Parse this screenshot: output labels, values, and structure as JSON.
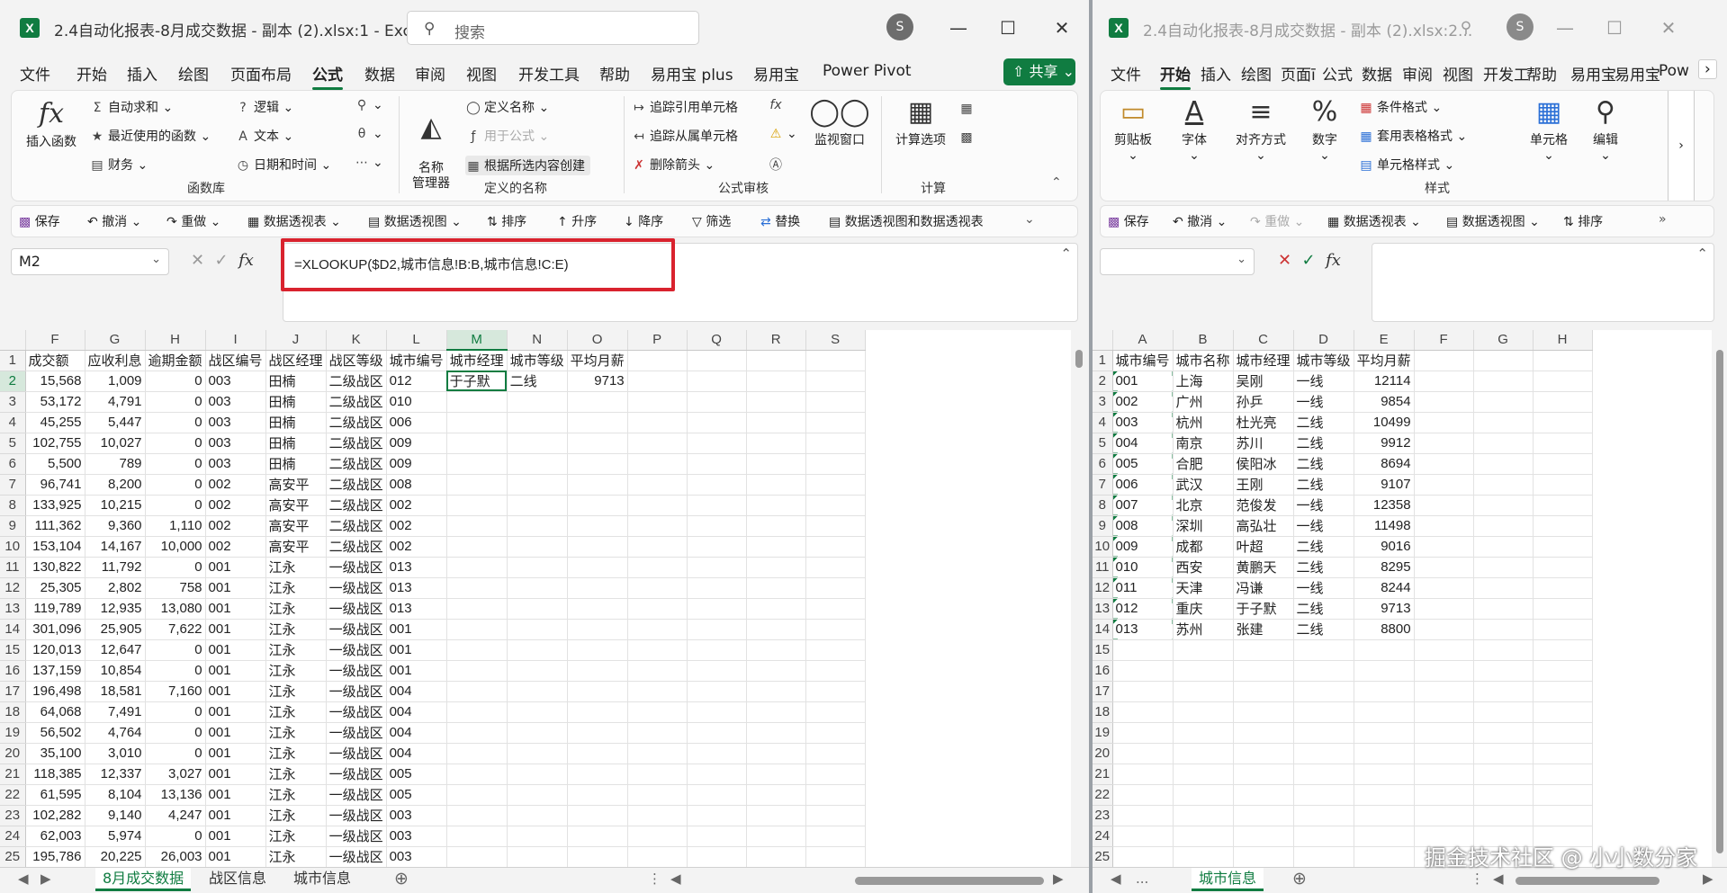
{
  "left": {
    "title": "2.4自动化报表-8月成交数据 - 副本 (2).xlsx:1  -  Excel",
    "logo": "X",
    "search_placeholder": "搜索",
    "avatar": "S",
    "menu": [
      "文件",
      "开始",
      "插入",
      "绘图",
      "页面布局",
      "公式",
      "数据",
      "审阅",
      "视图",
      "开发工具",
      "帮助",
      "易用宝 plus",
      "易用宝",
      "Power Pivot"
    ],
    "share": "共享",
    "ribbon": {
      "insert_function": "插入函数",
      "autosum": "自动求和",
      "recent": "最近使用的函数",
      "financial": "财务",
      "logical": "逻辑",
      "text": "文本",
      "datetime": "日期和时间",
      "group_library": "函数库",
      "name_manager": "名称\n管理器",
      "define_name": "定义名称",
      "use_in_formula": "用于公式",
      "create_from_selection": "根据所选内容创建",
      "group_names": "定义的名称",
      "trace_precedents": "追踪引用单元格",
      "trace_dependents": "追踪从属单元格",
      "remove_arrows": "删除箭头",
      "watch_window": "监视窗口",
      "group_audit": "公式审核",
      "calc_options": "计算选项",
      "group_calc": "计算"
    },
    "qat": [
      "保存",
      "撤消",
      "重做",
      "数据透视表",
      "数据透视图",
      "排序",
      "升序",
      "降序",
      "筛选",
      "替换",
      "数据透视图和数据透视表"
    ],
    "namebox": "M2",
    "formula": "=XLOOKUP($D2,城市信息!B:B,城市信息!C:E)",
    "columns": [
      "F",
      "G",
      "H",
      "I",
      "J",
      "K",
      "L",
      "M",
      "N",
      "O",
      "P",
      "Q",
      "R",
      "S"
    ],
    "rows": [
      [
        "成交额",
        "应收利息",
        "逾期金额",
        "战区编号",
        "战区经理",
        "战区等级",
        "城市编号",
        "城市经理",
        "城市等级",
        "平均月薪",
        "",
        "",
        "",
        ""
      ],
      [
        "15,568",
        "1,009",
        "0",
        "003",
        "田楠",
        "二级战区",
        "012",
        "于子默",
        "二线",
        "9713",
        "",
        "",
        "",
        ""
      ],
      [
        "53,172",
        "4,791",
        "0",
        "003",
        "田楠",
        "二级战区",
        "010",
        "",
        "",
        "",
        "",
        "",
        "",
        ""
      ],
      [
        "45,255",
        "5,447",
        "0",
        "003",
        "田楠",
        "二级战区",
        "006",
        "",
        "",
        "",
        "",
        "",
        "",
        ""
      ],
      [
        "102,755",
        "10,027",
        "0",
        "003",
        "田楠",
        "二级战区",
        "009",
        "",
        "",
        "",
        "",
        "",
        "",
        ""
      ],
      [
        "5,500",
        "789",
        "0",
        "003",
        "田楠",
        "二级战区",
        "009",
        "",
        "",
        "",
        "",
        "",
        "",
        ""
      ],
      [
        "96,741",
        "8,200",
        "0",
        "002",
        "高安平",
        "二级战区",
        "008",
        "",
        "",
        "",
        "",
        "",
        "",
        ""
      ],
      [
        "133,925",
        "10,215",
        "0",
        "002",
        "高安平",
        "二级战区",
        "002",
        "",
        "",
        "",
        "",
        "",
        "",
        ""
      ],
      [
        "111,362",
        "9,360",
        "1,110",
        "002",
        "高安平",
        "二级战区",
        "002",
        "",
        "",
        "",
        "",
        "",
        "",
        ""
      ],
      [
        "153,104",
        "14,167",
        "10,000",
        "002",
        "高安平",
        "二级战区",
        "002",
        "",
        "",
        "",
        "",
        "",
        "",
        ""
      ],
      [
        "130,822",
        "11,792",
        "0",
        "001",
        "江永",
        "一级战区",
        "013",
        "",
        "",
        "",
        "",
        "",
        "",
        ""
      ],
      [
        "25,305",
        "2,802",
        "758",
        "001",
        "江永",
        "一级战区",
        "013",
        "",
        "",
        "",
        "",
        "",
        "",
        ""
      ],
      [
        "119,789",
        "12,935",
        "13,080",
        "001",
        "江永",
        "一级战区",
        "013",
        "",
        "",
        "",
        "",
        "",
        "",
        ""
      ],
      [
        "301,096",
        "25,905",
        "7,622",
        "001",
        "江永",
        "一级战区",
        "001",
        "",
        "",
        "",
        "",
        "",
        "",
        ""
      ],
      [
        "120,013",
        "12,647",
        "0",
        "001",
        "江永",
        "一级战区",
        "001",
        "",
        "",
        "",
        "",
        "",
        "",
        ""
      ],
      [
        "137,159",
        "10,854",
        "0",
        "001",
        "江永",
        "一级战区",
        "001",
        "",
        "",
        "",
        "",
        "",
        "",
        ""
      ],
      [
        "196,498",
        "18,581",
        "7,160",
        "001",
        "江永",
        "一级战区",
        "004",
        "",
        "",
        "",
        "",
        "",
        "",
        ""
      ],
      [
        "64,068",
        "7,491",
        "0",
        "001",
        "江永",
        "一级战区",
        "004",
        "",
        "",
        "",
        "",
        "",
        "",
        ""
      ],
      [
        "56,502",
        "4,764",
        "0",
        "001",
        "江永",
        "一级战区",
        "004",
        "",
        "",
        "",
        "",
        "",
        "",
        ""
      ],
      [
        "35,100",
        "3,010",
        "0",
        "001",
        "江永",
        "一级战区",
        "004",
        "",
        "",
        "",
        "",
        "",
        "",
        ""
      ],
      [
        "118,385",
        "12,337",
        "3,027",
        "001",
        "江永",
        "一级战区",
        "005",
        "",
        "",
        "",
        "",
        "",
        "",
        ""
      ],
      [
        "61,595",
        "8,104",
        "13,136",
        "001",
        "江永",
        "一级战区",
        "005",
        "",
        "",
        "",
        "",
        "",
        "",
        ""
      ],
      [
        "102,282",
        "9,140",
        "4,247",
        "001",
        "江永",
        "一级战区",
        "003",
        "",
        "",
        "",
        "",
        "",
        "",
        ""
      ],
      [
        "62,003",
        "5,974",
        "0",
        "001",
        "江永",
        "一级战区",
        "003",
        "",
        "",
        "",
        "",
        "",
        "",
        ""
      ],
      [
        "195,786",
        "20,225",
        "26,003",
        "001",
        "江永",
        "一级战区",
        "003",
        "",
        "",
        "",
        "",
        "",
        "",
        ""
      ]
    ],
    "tabs": [
      "8月成交数据",
      "战区信息",
      "城市信息"
    ]
  },
  "right": {
    "title": "2.4自动化报表-8月成交数据 - 副本 (2).xlsx:2...",
    "logo": "X",
    "avatar": "S",
    "menu": [
      "文件",
      "开始",
      "插入",
      "绘图",
      "页面ī",
      "公式",
      "数据",
      "审阅",
      "视图",
      "开发工",
      "帮助",
      "易用宝",
      "易用宝",
      "Pow"
    ],
    "ribbon": {
      "clipboard": "剪贴板",
      "font": "字体",
      "alignment": "对齐方式",
      "number": "数字",
      "conditional": "条件格式",
      "table_format": "套用表格格式",
      "cell_style": "单元格样式",
      "group_styles": "样式",
      "cells": "单元格",
      "edit": "编辑"
    },
    "qat": [
      "保存",
      "撤消",
      "重做",
      "数据透视表",
      "数据透视图",
      "排序"
    ],
    "columns": [
      "A",
      "B",
      "C",
      "D",
      "E",
      "F",
      "G",
      "H"
    ],
    "rows": [
      [
        "城市编号",
        "城市名称",
        "城市经理",
        "城市等级",
        "平均月薪",
        "",
        "",
        ""
      ],
      [
        "001",
        "上海",
        "吴刚",
        "一线",
        "12114",
        "",
        "",
        ""
      ],
      [
        "002",
        "广州",
        "孙乒",
        "一线",
        "9854",
        "",
        "",
        ""
      ],
      [
        "003",
        "杭州",
        "杜光亮",
        "二线",
        "10499",
        "",
        "",
        ""
      ],
      [
        "004",
        "南京",
        "苏川",
        "二线",
        "9912",
        "",
        "",
        ""
      ],
      [
        "005",
        "合肥",
        "侯阳冰",
        "二线",
        "8694",
        "",
        "",
        ""
      ],
      [
        "006",
        "武汉",
        "王刚",
        "二线",
        "9107",
        "",
        "",
        ""
      ],
      [
        "007",
        "北京",
        "范俊发",
        "一线",
        "12358",
        "",
        "",
        ""
      ],
      [
        "008",
        "深圳",
        "高弘壮",
        "一线",
        "11498",
        "",
        "",
        ""
      ],
      [
        "009",
        "成都",
        "叶超",
        "二线",
        "9016",
        "",
        "",
        ""
      ],
      [
        "010",
        "西安",
        "黄鹏天",
        "二线",
        "8295",
        "",
        "",
        ""
      ],
      [
        "011",
        "天津",
        "冯谦",
        "一线",
        "8244",
        "",
        "",
        ""
      ],
      [
        "012",
        "重庆",
        "于子默",
        "二线",
        "9713",
        "",
        "",
        ""
      ],
      [
        "013",
        "苏州",
        "张建",
        "二线",
        "8800",
        "",
        "",
        ""
      ],
      [
        "",
        "",
        "",
        "",
        "",
        "",
        "",
        ""
      ],
      [
        "",
        "",
        "",
        "",
        "",
        "",
        "",
        ""
      ],
      [
        "",
        "",
        "",
        "",
        "",
        "",
        "",
        ""
      ],
      [
        "",
        "",
        "",
        "",
        "",
        "",
        "",
        ""
      ],
      [
        "",
        "",
        "",
        "",
        "",
        "",
        "",
        ""
      ],
      [
        "",
        "",
        "",
        "",
        "",
        "",
        "",
        ""
      ],
      [
        "",
        "",
        "",
        "",
        "",
        "",
        "",
        ""
      ],
      [
        "",
        "",
        "",
        "",
        "",
        "",
        "",
        ""
      ],
      [
        "",
        "",
        "",
        "",
        "",
        "",
        "",
        ""
      ],
      [
        "",
        "",
        "",
        "",
        "",
        "",
        "",
        ""
      ],
      [
        "",
        "",
        "",
        "",
        "",
        "",
        "",
        ""
      ]
    ],
    "tabs": [
      "城市信息"
    ],
    "tab_dots": "..."
  },
  "watermark": "掘金技术社区 @ 小小数分家",
  "colors": {
    "accent": "#107c41",
    "highlight": "#d9232e"
  }
}
